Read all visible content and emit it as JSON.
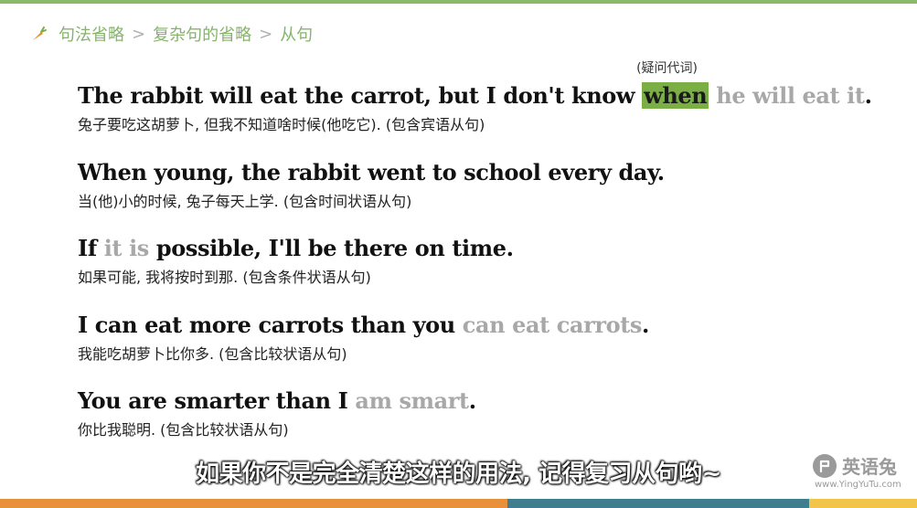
{
  "colors": {
    "accent": "#86b36b",
    "highlight": "#7bae44",
    "omitted_text": "#a8a8a8"
  },
  "breadcrumb": {
    "icon": "carrot-icon",
    "items": [
      "句法省略",
      "复杂句的省略",
      "从句"
    ],
    "separator": ">"
  },
  "examples": [
    {
      "en": {
        "before": "The rabbit will eat the carrot, but I don't know ",
        "highlight": "when",
        "omitted": " he will eat it",
        "after": "."
      },
      "note": "(疑问代词)",
      "zh": "兔子要吃这胡萝卜, 但我不知道啥时候(他吃它).  (包含宾语从句)"
    },
    {
      "en": {
        "main": "When young, the rabbit went to school every day."
      },
      "zh": "当(他)小的时候, 兔子每天上学.  (包含时间状语从句)"
    },
    {
      "en": {
        "before": "If ",
        "omitted": "it is",
        "after": " possible, I'll be there on time."
      },
      "zh": "如果可能, 我将按时到那.  (包含条件状语从句)"
    },
    {
      "en": {
        "before": "I can eat more carrots than you ",
        "omitted": "can eat carrots",
        "after": "."
      },
      "zh": "我能吃胡萝卜比你多.  (包含比较状语从句)"
    },
    {
      "en": {
        "before": "You are smarter than I ",
        "omitted": "am smart",
        "after": "."
      },
      "zh": "你比我聪明.  (包含比较状语从句)"
    }
  ],
  "subtitle": "如果你不是完全清楚这样的用法, 记得复习从句哟~",
  "brand": {
    "logo_icon": "rabbit-logo-icon",
    "name": "英语兔",
    "url": "www.YingYuTu.com"
  }
}
